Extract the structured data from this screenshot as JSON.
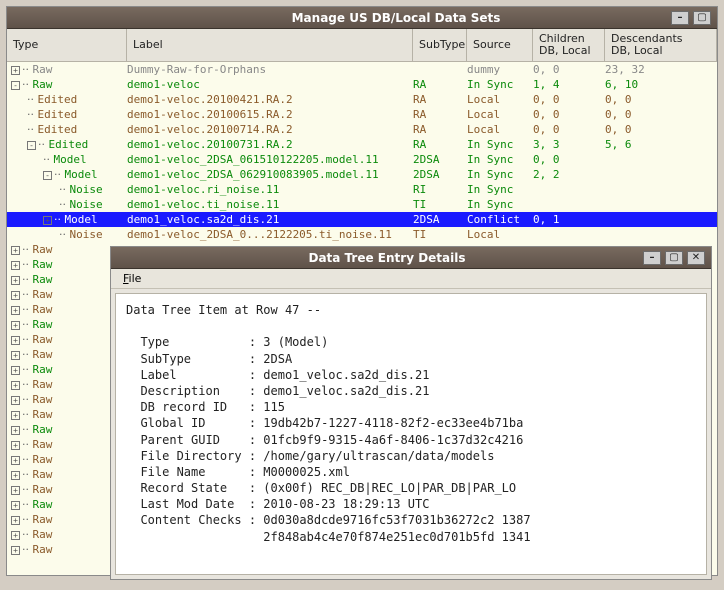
{
  "main_window": {
    "title": "Manage US DB/Local Data Sets"
  },
  "columns": {
    "type": "Type",
    "label": "Label",
    "subtype": "SubType",
    "source": "Source",
    "children": "Children\nDB, Local",
    "descendants": "Descendants\nDB, Local"
  },
  "rows": [
    {
      "indent": 0,
      "exp": "plus",
      "style": "grey",
      "type": "Raw",
      "label": "Dummy-Raw-for-Orphans",
      "subtype": "",
      "source": "dummy",
      "children": "0, 0",
      "desc": "23, 32"
    },
    {
      "indent": 0,
      "exp": "minus",
      "style": "green",
      "type": "Raw",
      "label": "demo1-veloc",
      "subtype": "RA",
      "source": "In Sync",
      "children": "1, 4",
      "desc": "6, 10"
    },
    {
      "indent": 1,
      "exp": "none",
      "style": "brown",
      "type": "Edited",
      "label": "demo1-veloc.20100421.RA.2",
      "subtype": "RA",
      "source": "Local",
      "children": "0, 0",
      "desc": "0, 0"
    },
    {
      "indent": 1,
      "exp": "none",
      "style": "brown",
      "type": "Edited",
      "label": "demo1-veloc.20100615.RA.2",
      "subtype": "RA",
      "source": "Local",
      "children": "0, 0",
      "desc": "0, 0"
    },
    {
      "indent": 1,
      "exp": "none",
      "style": "brown",
      "type": "Edited",
      "label": "demo1-veloc.20100714.RA.2",
      "subtype": "RA",
      "source": "Local",
      "children": "0, 0",
      "desc": "0, 0"
    },
    {
      "indent": 1,
      "exp": "minus",
      "style": "green",
      "type": "Edited",
      "label": "demo1-veloc.20100731.RA.2",
      "subtype": "RA",
      "source": "In Sync",
      "children": "3, 3",
      "desc": "5, 6"
    },
    {
      "indent": 2,
      "exp": "none",
      "style": "green",
      "type": "Model",
      "label": "demo1-veloc_2DSA_061510122205.model.11",
      "subtype": "2DSA",
      "source": "In Sync",
      "children": "0, 0",
      "desc": ""
    },
    {
      "indent": 2,
      "exp": "minus",
      "style": "green",
      "type": "Model",
      "label": "demo1-veloc_2DSA_062910083905.model.11",
      "subtype": "2DSA",
      "source": "In Sync",
      "children": "2, 2",
      "desc": ""
    },
    {
      "indent": 3,
      "exp": "none",
      "style": "green",
      "type": "Noise",
      "label": "demo1-veloc.ri_noise.11",
      "subtype": "RI",
      "source": "In Sync",
      "children": "",
      "desc": ""
    },
    {
      "indent": 3,
      "exp": "none",
      "style": "green",
      "type": "Noise",
      "label": "demo1-veloc.ti_noise.11",
      "subtype": "TI",
      "source": "In Sync",
      "children": "",
      "desc": ""
    },
    {
      "indent": 2,
      "exp": "plus",
      "style": "sel",
      "type": "Model",
      "label": "demo1_veloc.sa2d_dis.21",
      "subtype": "2DSA",
      "source": "Conflict",
      "children": "0, 1",
      "desc": ""
    },
    {
      "indent": 3,
      "exp": "none",
      "style": "brown",
      "type": "Noise",
      "label": "demo1-veloc_2DSA_0...2122205.ti_noise.11",
      "subtype": "TI",
      "source": "Local",
      "children": "",
      "desc": ""
    },
    {
      "indent": 0,
      "exp": "plus",
      "style": "brown",
      "type": "Raw",
      "label": "",
      "subtype": "",
      "source": "",
      "children": "",
      "desc": ""
    },
    {
      "indent": 0,
      "exp": "plus",
      "style": "green",
      "type": "Raw",
      "label": "",
      "subtype": "",
      "source": "",
      "children": "",
      "desc": ""
    },
    {
      "indent": 0,
      "exp": "plus",
      "style": "green",
      "type": "Raw",
      "label": "",
      "subtype": "",
      "source": "",
      "children": "",
      "desc": ""
    },
    {
      "indent": 0,
      "exp": "plus",
      "style": "brown",
      "type": "Raw",
      "label": "",
      "subtype": "",
      "source": "",
      "children": "",
      "desc": ""
    },
    {
      "indent": 0,
      "exp": "plus",
      "style": "brown",
      "type": "Raw",
      "label": "",
      "subtype": "",
      "source": "",
      "children": "",
      "desc": ""
    },
    {
      "indent": 0,
      "exp": "plus",
      "style": "green",
      "type": "Raw",
      "label": "",
      "subtype": "",
      "source": "",
      "children": "",
      "desc": ""
    },
    {
      "indent": 0,
      "exp": "plus",
      "style": "brown",
      "type": "Raw",
      "label": "",
      "subtype": "",
      "source": "",
      "children": "",
      "desc": ""
    },
    {
      "indent": 0,
      "exp": "plus",
      "style": "brown",
      "type": "Raw",
      "label": "",
      "subtype": "",
      "source": "",
      "children": "",
      "desc": ""
    },
    {
      "indent": 0,
      "exp": "plus",
      "style": "green",
      "type": "Raw",
      "label": "",
      "subtype": "",
      "source": "",
      "children": "",
      "desc": ""
    },
    {
      "indent": 0,
      "exp": "plus",
      "style": "brown",
      "type": "Raw",
      "label": "",
      "subtype": "",
      "source": "",
      "children": "",
      "desc": ""
    },
    {
      "indent": 0,
      "exp": "plus",
      "style": "brown",
      "type": "Raw",
      "label": "",
      "subtype": "",
      "source": "",
      "children": "",
      "desc": ""
    },
    {
      "indent": 0,
      "exp": "plus",
      "style": "brown",
      "type": "Raw",
      "label": "",
      "subtype": "",
      "source": "",
      "children": "",
      "desc": ""
    },
    {
      "indent": 0,
      "exp": "plus",
      "style": "green",
      "type": "Raw",
      "label": "",
      "subtype": "",
      "source": "",
      "children": "",
      "desc": ""
    },
    {
      "indent": 0,
      "exp": "plus",
      "style": "brown",
      "type": "Raw",
      "label": "",
      "subtype": "",
      "source": "",
      "children": "",
      "desc": ""
    },
    {
      "indent": 0,
      "exp": "plus",
      "style": "brown",
      "type": "Raw",
      "label": "",
      "subtype": "",
      "source": "",
      "children": "",
      "desc": ""
    },
    {
      "indent": 0,
      "exp": "plus",
      "style": "brown",
      "type": "Raw",
      "label": "",
      "subtype": "",
      "source": "",
      "children": "",
      "desc": ""
    },
    {
      "indent": 0,
      "exp": "plus",
      "style": "brown",
      "type": "Raw",
      "label": "",
      "subtype": "",
      "source": "",
      "children": "",
      "desc": ""
    },
    {
      "indent": 0,
      "exp": "plus",
      "style": "green",
      "type": "Raw",
      "label": "",
      "subtype": "",
      "source": "",
      "children": "",
      "desc": ""
    },
    {
      "indent": 0,
      "exp": "plus",
      "style": "brown",
      "type": "Raw",
      "label": "",
      "subtype": "",
      "source": "",
      "children": "",
      "desc": ""
    },
    {
      "indent": 0,
      "exp": "plus",
      "style": "brown",
      "type": "Raw",
      "label": "",
      "subtype": "",
      "source": "",
      "children": "",
      "desc": ""
    },
    {
      "indent": 0,
      "exp": "plus",
      "style": "brown",
      "type": "Raw",
      "label": "",
      "subtype": "",
      "source": "",
      "children": "",
      "desc": ""
    }
  ],
  "detail_window": {
    "title": "Data Tree Entry Details",
    "menu_file": "File",
    "heading": "Data Tree Item at Row 47 --",
    "fields": [
      [
        "Type",
        "3 (Model)"
      ],
      [
        "SubType",
        "2DSA"
      ],
      [
        "Label",
        "demo1_veloc.sa2d_dis.21"
      ],
      [
        "Description",
        "demo1_veloc.sa2d_dis.21"
      ],
      [
        "DB record ID",
        "115"
      ],
      [
        "Global ID",
        "19db42b7-1227-4118-82f2-ec33ee4b71ba"
      ],
      [
        "Parent GUID",
        "01fcb9f9-9315-4a6f-8406-1c37d32c4216"
      ],
      [
        "File Directory",
        "/home/gary/ultrascan/data/models"
      ],
      [
        "File Name",
        "M0000025.xml"
      ],
      [
        "Record State",
        "(0x00f) REC_DB|REC_LO|PAR_DB|PAR_LO"
      ],
      [
        "Last Mod Date",
        "2010-08-23 18:29:13 UTC"
      ],
      [
        "Content Checks",
        "0d030a8dcde9716fc53f7031b36272c2 1387"
      ],
      [
        "",
        "2f848ab4c4e70f874e251ec0d701b5fd 1341"
      ]
    ]
  }
}
